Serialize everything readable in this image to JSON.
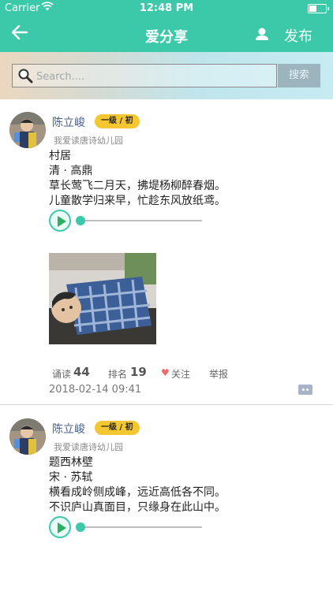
{
  "status_bar": {
    "carrier": "Carrier",
    "time": "12:48 PM"
  },
  "nav": {
    "title": "爱分享",
    "publish": "发布",
    "back_icon": "arrow-left-icon",
    "user_icon": "user-icon"
  },
  "search": {
    "placeholder": "Search....",
    "button": "搜索",
    "icon": "search-icon"
  },
  "posts": [
    {
      "username": "陈立峻",
      "level": "一级 / 初",
      "school": "我爱读唐诗幼儿园",
      "poem": [
        "村居",
        "清 · 高鼎",
        "草长莺飞二月天，拂堤杨柳醉春烟。",
        "儿童散学归来早，忙趁东风放纸鸢。"
      ],
      "audio_progress": 0,
      "read_label": "诵读",
      "read_count": "44",
      "rank_label": "排名",
      "rank": "19",
      "follow": "关注",
      "report": "举报",
      "timestamp": "2018-02-14 09:41"
    },
    {
      "username": "陈立峻",
      "level": "一级 / 初",
      "school": "我爱读唐诗幼儿园",
      "poem": [
        "题西林壁",
        "宋 · 苏轼",
        "横看成岭侧成峰，远近高低各不同。",
        "不识庐山真面目，只缘身在此山中。"
      ],
      "audio_progress": 0
    }
  ],
  "colors": {
    "brand": "#3cc9a9",
    "badge": "#f4c630",
    "username": "#4a5f8e",
    "heart": "#f06a6a"
  }
}
